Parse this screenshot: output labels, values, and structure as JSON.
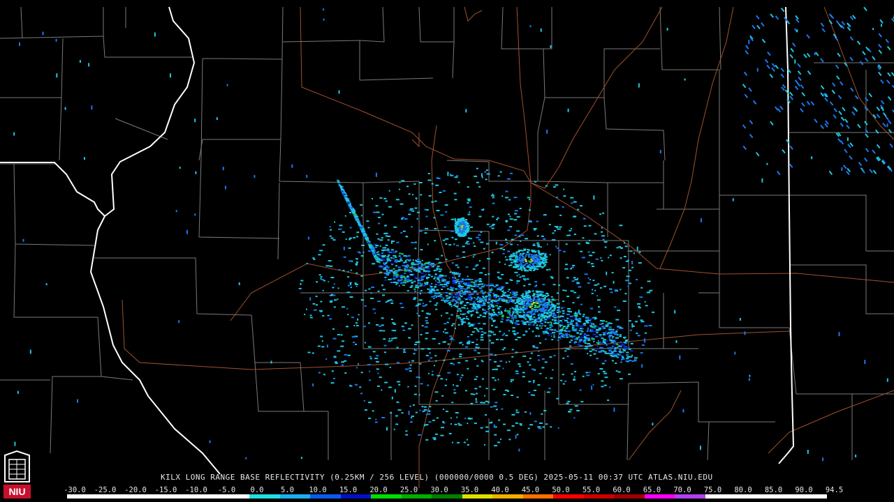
{
  "product": {
    "caption": "KILX LONG RANGE BASE REFLECTIVITY (0.25KM / 256 LEVEL) (000000/0000 0.5 DEG) 2025-05-11 00:37 UTC  ATLAS.NIU.EDU"
  },
  "logo": {
    "text": "NIU",
    "color": "#c8102e"
  },
  "legend": {
    "labels": [
      "-30.0",
      "-25.0",
      "-20.0",
      "-15.0",
      "-10.0",
      "-5.0",
      "0.0",
      "5.0",
      "10.0",
      "15.0",
      "20.0",
      "25.0",
      "30.0",
      "35.0",
      "40.0",
      "45.0",
      "50.0",
      "55.0",
      "60.0",
      "65.0",
      "70.0",
      "75.0",
      "80.0",
      "85.0",
      "90.0",
      "94.5"
    ],
    "colors": [
      "#ffffff",
      "#ffffff",
      "#ffffff",
      "#ffffff",
      "#ffffff",
      "#ffffff",
      "#20e0e0",
      "#1ab0f0",
      "#0a5af0",
      "#0010c8",
      "#00e000",
      "#00b000",
      "#008000",
      "#e0e000",
      "#f0b000",
      "#ff7000",
      "#ff0000",
      "#d00000",
      "#a00000",
      "#ff00ff",
      "#b040f0",
      "#ffffff",
      "#ffffff",
      "#ffffff",
      "#ffffff"
    ]
  },
  "colors": {
    "county": "#7a7a7a",
    "state": "#ffffff",
    "highway": "#a0522d",
    "echo_light": "#1ec8e0",
    "echo_mid": "#1a78f0",
    "echo_dark": "#0a28c8",
    "echo_green": "#20c040",
    "echo_yellow": "#e8e020"
  }
}
